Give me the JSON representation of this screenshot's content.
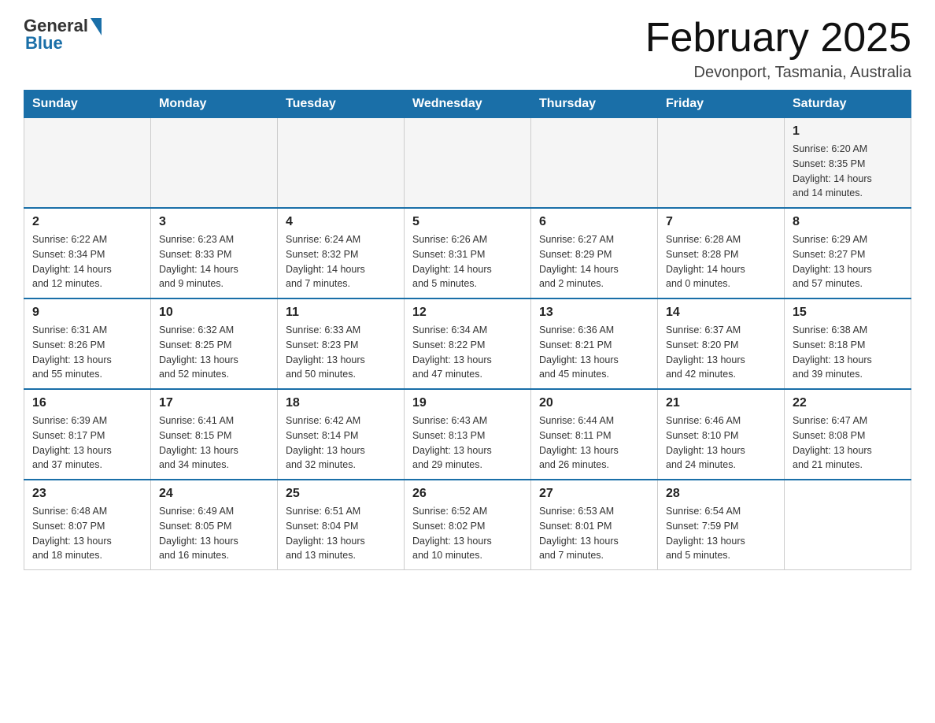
{
  "logo": {
    "general": "General",
    "blue": "Blue"
  },
  "title": "February 2025",
  "subtitle": "Devonport, Tasmania, Australia",
  "days_of_week": [
    "Sunday",
    "Monday",
    "Tuesday",
    "Wednesday",
    "Thursday",
    "Friday",
    "Saturday"
  ],
  "weeks": [
    [
      {
        "day": "",
        "info": ""
      },
      {
        "day": "",
        "info": ""
      },
      {
        "day": "",
        "info": ""
      },
      {
        "day": "",
        "info": ""
      },
      {
        "day": "",
        "info": ""
      },
      {
        "day": "",
        "info": ""
      },
      {
        "day": "1",
        "info": "Sunrise: 6:20 AM\nSunset: 8:35 PM\nDaylight: 14 hours\nand 14 minutes."
      }
    ],
    [
      {
        "day": "2",
        "info": "Sunrise: 6:22 AM\nSunset: 8:34 PM\nDaylight: 14 hours\nand 12 minutes."
      },
      {
        "day": "3",
        "info": "Sunrise: 6:23 AM\nSunset: 8:33 PM\nDaylight: 14 hours\nand 9 minutes."
      },
      {
        "day": "4",
        "info": "Sunrise: 6:24 AM\nSunset: 8:32 PM\nDaylight: 14 hours\nand 7 minutes."
      },
      {
        "day": "5",
        "info": "Sunrise: 6:26 AM\nSunset: 8:31 PM\nDaylight: 14 hours\nand 5 minutes."
      },
      {
        "day": "6",
        "info": "Sunrise: 6:27 AM\nSunset: 8:29 PM\nDaylight: 14 hours\nand 2 minutes."
      },
      {
        "day": "7",
        "info": "Sunrise: 6:28 AM\nSunset: 8:28 PM\nDaylight: 14 hours\nand 0 minutes."
      },
      {
        "day": "8",
        "info": "Sunrise: 6:29 AM\nSunset: 8:27 PM\nDaylight: 13 hours\nand 57 minutes."
      }
    ],
    [
      {
        "day": "9",
        "info": "Sunrise: 6:31 AM\nSunset: 8:26 PM\nDaylight: 13 hours\nand 55 minutes."
      },
      {
        "day": "10",
        "info": "Sunrise: 6:32 AM\nSunset: 8:25 PM\nDaylight: 13 hours\nand 52 minutes."
      },
      {
        "day": "11",
        "info": "Sunrise: 6:33 AM\nSunset: 8:23 PM\nDaylight: 13 hours\nand 50 minutes."
      },
      {
        "day": "12",
        "info": "Sunrise: 6:34 AM\nSunset: 8:22 PM\nDaylight: 13 hours\nand 47 minutes."
      },
      {
        "day": "13",
        "info": "Sunrise: 6:36 AM\nSunset: 8:21 PM\nDaylight: 13 hours\nand 45 minutes."
      },
      {
        "day": "14",
        "info": "Sunrise: 6:37 AM\nSunset: 8:20 PM\nDaylight: 13 hours\nand 42 minutes."
      },
      {
        "day": "15",
        "info": "Sunrise: 6:38 AM\nSunset: 8:18 PM\nDaylight: 13 hours\nand 39 minutes."
      }
    ],
    [
      {
        "day": "16",
        "info": "Sunrise: 6:39 AM\nSunset: 8:17 PM\nDaylight: 13 hours\nand 37 minutes."
      },
      {
        "day": "17",
        "info": "Sunrise: 6:41 AM\nSunset: 8:15 PM\nDaylight: 13 hours\nand 34 minutes."
      },
      {
        "day": "18",
        "info": "Sunrise: 6:42 AM\nSunset: 8:14 PM\nDaylight: 13 hours\nand 32 minutes."
      },
      {
        "day": "19",
        "info": "Sunrise: 6:43 AM\nSunset: 8:13 PM\nDaylight: 13 hours\nand 29 minutes."
      },
      {
        "day": "20",
        "info": "Sunrise: 6:44 AM\nSunset: 8:11 PM\nDaylight: 13 hours\nand 26 minutes."
      },
      {
        "day": "21",
        "info": "Sunrise: 6:46 AM\nSunset: 8:10 PM\nDaylight: 13 hours\nand 24 minutes."
      },
      {
        "day": "22",
        "info": "Sunrise: 6:47 AM\nSunset: 8:08 PM\nDaylight: 13 hours\nand 21 minutes."
      }
    ],
    [
      {
        "day": "23",
        "info": "Sunrise: 6:48 AM\nSunset: 8:07 PM\nDaylight: 13 hours\nand 18 minutes."
      },
      {
        "day": "24",
        "info": "Sunrise: 6:49 AM\nSunset: 8:05 PM\nDaylight: 13 hours\nand 16 minutes."
      },
      {
        "day": "25",
        "info": "Sunrise: 6:51 AM\nSunset: 8:04 PM\nDaylight: 13 hours\nand 13 minutes."
      },
      {
        "day": "26",
        "info": "Sunrise: 6:52 AM\nSunset: 8:02 PM\nDaylight: 13 hours\nand 10 minutes."
      },
      {
        "day": "27",
        "info": "Sunrise: 6:53 AM\nSunset: 8:01 PM\nDaylight: 13 hours\nand 7 minutes."
      },
      {
        "day": "28",
        "info": "Sunrise: 6:54 AM\nSunset: 7:59 PM\nDaylight: 13 hours\nand 5 minutes."
      },
      {
        "day": "",
        "info": ""
      }
    ]
  ]
}
